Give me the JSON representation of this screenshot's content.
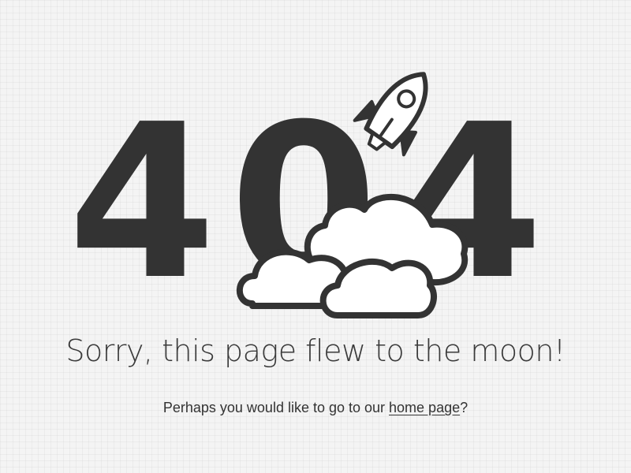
{
  "hero": {
    "code_first_digit": "4",
    "code_second_digit": "0",
    "code_third_digit": "4",
    "digit_color": "#333333",
    "cloud_fill": "#ffffff",
    "rocket_icon": "rocket-icon",
    "cloud_icon": "cloud-icon"
  },
  "message": {
    "headline": "Sorry, this page flew to the moon!",
    "sub_prefix": "Perhaps you would like to go to our ",
    "link_label": "home page",
    "sub_suffix": "?"
  },
  "colors": {
    "background": "#f4f4f4",
    "text": "#333333",
    "accent": "#333333"
  }
}
